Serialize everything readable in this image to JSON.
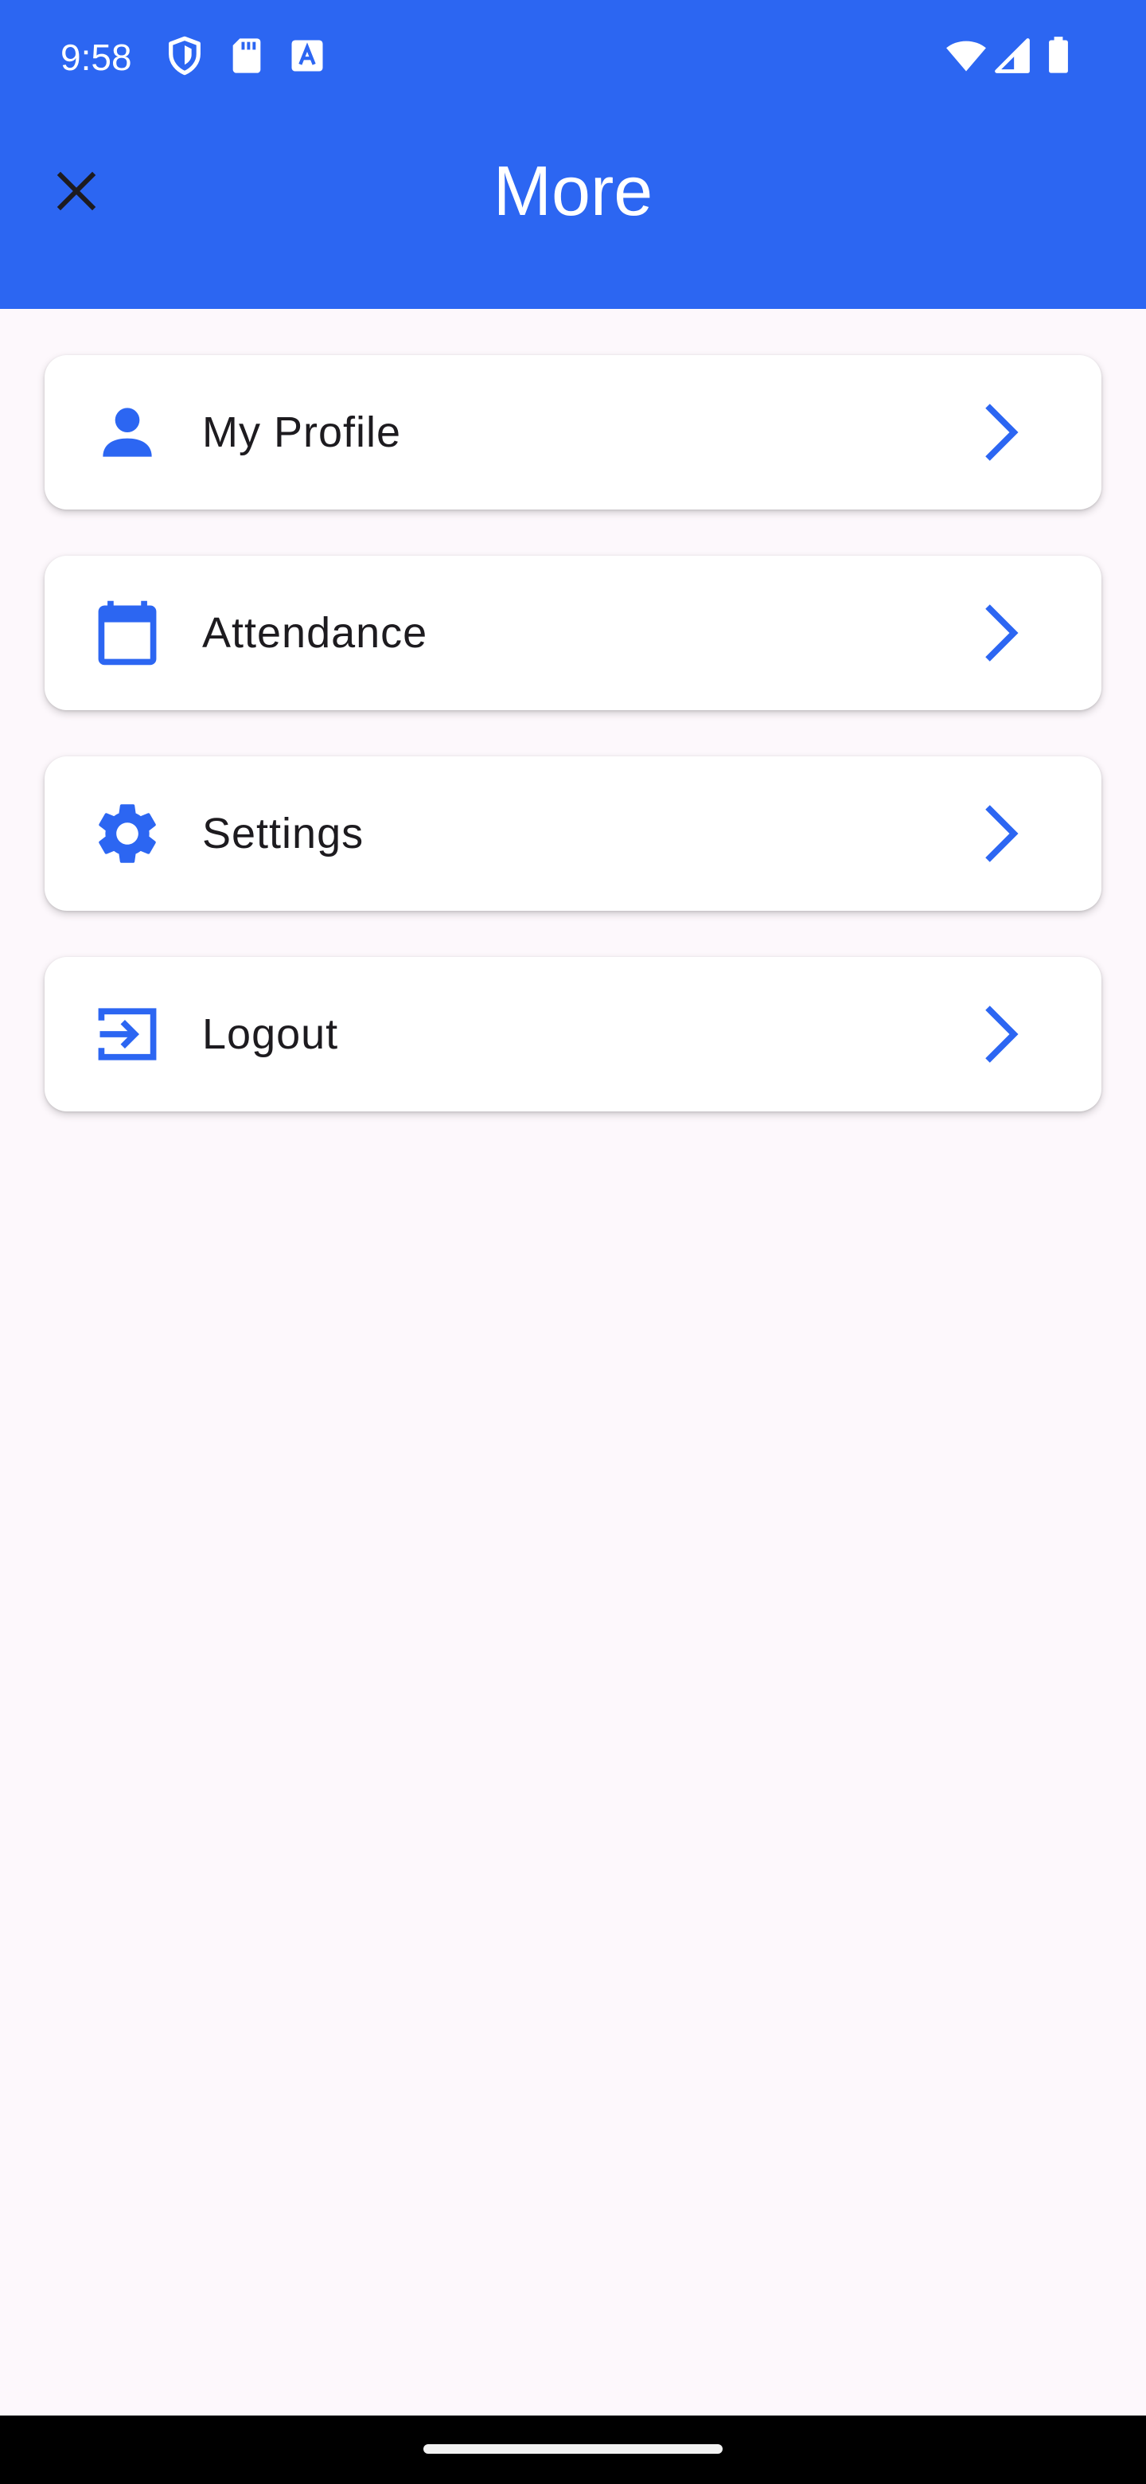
{
  "status_bar": {
    "time": "9:58",
    "icons": [
      "shield-icon",
      "sd-card-icon",
      "text-a-icon",
      "wifi-icon",
      "signal-icon",
      "battery-icon"
    ]
  },
  "header": {
    "title": "More",
    "close_icon": "close-icon",
    "background_color": "#2c66f2"
  },
  "menu": {
    "accent_color": "#2c66f2",
    "items": [
      {
        "label": "My Profile",
        "icon": "person-icon"
      },
      {
        "label": "Attendance",
        "icon": "calendar-icon"
      },
      {
        "label": "Settings",
        "icon": "gear-icon"
      },
      {
        "label": "Logout",
        "icon": "logout-icon"
      }
    ]
  }
}
